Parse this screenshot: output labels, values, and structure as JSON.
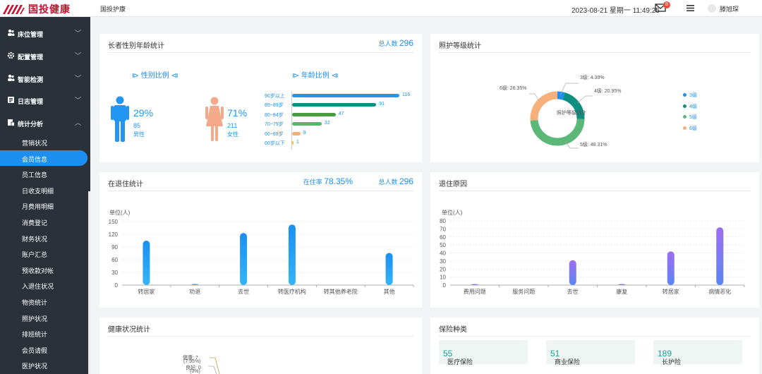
{
  "app": {
    "logo_text": "国投健康",
    "page_title": "国投护康",
    "datetime": "2023-08-21 星期一 11:49:25",
    "mail_badge": "8",
    "username": "滕旭琛"
  },
  "sidebar": {
    "groups": [
      {
        "icon": "users-icon",
        "label": "床位管理"
      },
      {
        "icon": "gear-icon",
        "label": "配置管理"
      },
      {
        "icon": "users-icon",
        "label": "智能检测"
      },
      {
        "icon": "log-icon",
        "label": "日志管理"
      },
      {
        "icon": "chart-icon",
        "label": "统计分析"
      }
    ],
    "items": [
      "营销状况",
      "会员信息",
      "员工信息",
      "日收支明细",
      "月费用明细",
      "消费登记",
      "财务状况",
      "账户汇总",
      "预收款对帐",
      "入退住状况",
      "物资统计",
      "照护状况",
      "排班统计",
      "会员请假",
      "医护状况"
    ],
    "active_index": 1
  },
  "gender_age": {
    "title": "长者性别年龄统计",
    "total_label": "总人数",
    "total": "296",
    "gender_head": "性别比例",
    "age_head": "年龄比例",
    "male": {
      "pct": "29%",
      "count": "85",
      "label": "男性"
    },
    "female": {
      "pct": "71%",
      "count": "211",
      "label": "女性"
    },
    "ages": [
      {
        "label": "90岁以上",
        "value": 116,
        "value_text": "116",
        "color": "#2196f3"
      },
      {
        "label": "85~89岁",
        "value": 91,
        "value_text": "91",
        "color": "#0e8f80"
      },
      {
        "label": "80~84岁",
        "value": 47,
        "value_text": "47",
        "color": "#4a9a3f"
      },
      {
        "label": "70~79岁",
        "value": 32,
        "value_text": "32",
        "color": "#55b86a"
      },
      {
        "label": "60~69岁",
        "value": 9,
        "value_text": "9",
        "color": "#f8b07a"
      },
      {
        "label": "60岁以下",
        "value": 1,
        "value_text": "1",
        "color": "#f5c518"
      }
    ]
  },
  "care_level": {
    "title": "照护等级统计",
    "center": "照护等级统计",
    "slices": [
      {
        "name": "3级",
        "pct": 4.39,
        "label": "3级: 4.39%",
        "color": "#1c8ff0"
      },
      {
        "name": "4级",
        "pct": 20.95,
        "label": "4级: 20.95%",
        "color": "#0e8f80"
      },
      {
        "name": "5级",
        "pct": 48.31,
        "label": "5级: 48.31%",
        "color": "#5cb878"
      },
      {
        "name": "6级",
        "pct": 26.35,
        "label": "6级: 26.35%",
        "color": "#f8b07a"
      }
    ]
  },
  "residence": {
    "title": "在退住统计",
    "rate_label": "在住率",
    "rate": "78.35%",
    "total_label": "总人数",
    "total": "296",
    "chart_data": {
      "type": "bar",
      "ylabel": "单位(人)",
      "ylim": [
        0,
        150
      ],
      "yticks": [
        "0",
        "30",
        "60",
        "90",
        "120",
        "150"
      ],
      "categories": [
        "转居家",
        "劝退",
        "去世",
        "转医疗机构",
        "转其他养老院",
        "其他"
      ],
      "values": [
        105,
        1,
        123,
        143,
        0,
        76
      ]
    }
  },
  "leave_reason": {
    "title": "退住原因",
    "chart_data": {
      "type": "bar",
      "ylabel": "单位(人)",
      "ylim": [
        0,
        80
      ],
      "yticks": [
        "0",
        "10",
        "20",
        "30",
        "40",
        "50",
        "60",
        "70",
        "80"
      ],
      "categories": [
        "费用问题",
        "服务问题",
        "去世",
        "康复",
        "转居家",
        "病情恶化"
      ],
      "values": [
        1,
        0,
        31,
        1,
        42,
        72
      ]
    }
  },
  "health": {
    "title": "健康状况统计",
    "labels": [
      "健康: 7",
      "(7.95%)",
      "良好: 0",
      "(0%)"
    ]
  },
  "insurance": {
    "title": "保险种类",
    "items": [
      {
        "label": "医疗保险",
        "value": "55"
      },
      {
        "label": "商业保险",
        "value": "51"
      },
      {
        "label": "长护险",
        "value": "189"
      }
    ]
  }
}
